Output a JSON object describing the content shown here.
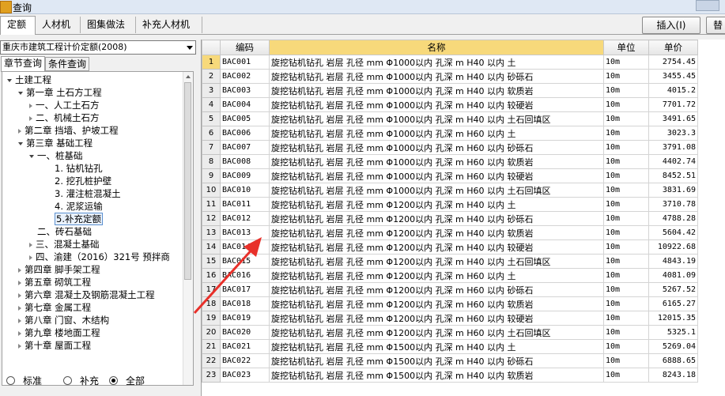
{
  "window": {
    "title": "查询",
    "icon": "app-icon"
  },
  "tabs": [
    {
      "label": "定额",
      "active": true
    },
    {
      "label": "人材机",
      "active": false
    },
    {
      "label": "图集做法",
      "active": false
    },
    {
      "label": "补充人材机",
      "active": false
    }
  ],
  "toolbar": {
    "insert_label": "插入(I)",
    "replace_label": "替"
  },
  "left": {
    "dropdown_value": "重庆市建筑工程计价定额(2008)",
    "subtabs": [
      {
        "label": "章节查询",
        "active": true
      },
      {
        "label": "条件查询",
        "active": false
      }
    ],
    "tree": [
      {
        "label": "土建工程",
        "level": 0,
        "toggle": "open"
      },
      {
        "label": "第一章  土石方工程",
        "level": 1,
        "toggle": "open"
      },
      {
        "label": "一、人工土石方",
        "level": 2,
        "toggle": "closed"
      },
      {
        "label": "二、机械土石方",
        "level": 2,
        "toggle": "closed"
      },
      {
        "label": "第二章  挡墙、护坡工程",
        "level": 1,
        "toggle": "closed"
      },
      {
        "label": "第三章  基础工程",
        "level": 1,
        "toggle": "open"
      },
      {
        "label": "一、桩基础",
        "level": 2,
        "toggle": "open"
      },
      {
        "label": "1. 钻机钻孔",
        "level": 3,
        "toggle": "none"
      },
      {
        "label": "2. 挖孔桩护壁",
        "level": 3,
        "toggle": "none"
      },
      {
        "label": "3. 灌注桩混凝土",
        "level": 3,
        "toggle": "none"
      },
      {
        "label": "4. 泥浆运输",
        "level": 3,
        "toggle": "none"
      },
      {
        "label": "5.补充定额",
        "level": 3,
        "toggle": "none",
        "selected": true
      },
      {
        "label": "二、砖石基础",
        "level": 2,
        "toggle": "none"
      },
      {
        "label": "三、混凝土基础",
        "level": 2,
        "toggle": "closed"
      },
      {
        "label": "四、渝建（2016）321号 预拌商",
        "level": 2,
        "toggle": "closed"
      },
      {
        "label": "第四章  脚手架工程",
        "level": 1,
        "toggle": "closed"
      },
      {
        "label": "第五章  砌筑工程",
        "level": 1,
        "toggle": "closed"
      },
      {
        "label": "第六章  混凝土及钢筋混凝土工程",
        "level": 1,
        "toggle": "closed"
      },
      {
        "label": "第七章  金属工程",
        "level": 1,
        "toggle": "closed"
      },
      {
        "label": "第八章  门窗、木结构",
        "level": 1,
        "toggle": "closed"
      },
      {
        "label": "第九章  楼地面工程",
        "level": 1,
        "toggle": "closed"
      },
      {
        "label": "第十章  屋面工程",
        "level": 1,
        "toggle": "closed"
      }
    ],
    "radios": [
      {
        "label": "标准",
        "checked": false
      },
      {
        "label": "补充",
        "checked": false
      },
      {
        "label": "全部",
        "checked": true
      }
    ]
  },
  "grid": {
    "headers": {
      "code": "编码",
      "name": "名称",
      "unit": "单位",
      "price": "单价"
    },
    "rows": [
      {
        "n": "1",
        "code": "BAC001",
        "name": "旋挖钻机钻孔 岩层 孔径 mm Φ1000以内 孔深 m H40 以内 土",
        "unit": "10m",
        "price": "2754.45"
      },
      {
        "n": "2",
        "code": "BAC002",
        "name": "旋挖钻机钻孔 岩层 孔径 mm Φ1000以内 孔深 m H40 以内 砂砾石",
        "unit": "10m",
        "price": "3455.45"
      },
      {
        "n": "3",
        "code": "BAC003",
        "name": "旋挖钻机钻孔 岩层 孔径 mm Φ1000以内 孔深 m H40 以内 软质岩",
        "unit": "10m",
        "price": "4015.2"
      },
      {
        "n": "4",
        "code": "BAC004",
        "name": "旋挖钻机钻孔 岩层 孔径 mm Φ1000以内 孔深 m H40 以内 较硬岩",
        "unit": "10m",
        "price": "7701.72"
      },
      {
        "n": "5",
        "code": "BAC005",
        "name": "旋挖钻机钻孔 岩层 孔径 mm Φ1000以内 孔深 m H40 以内 土石回填区",
        "unit": "10m",
        "price": "3491.65"
      },
      {
        "n": "6",
        "code": "BAC006",
        "name": "旋挖钻机钻孔 岩层 孔径 mm Φ1000以内 孔深 m H60 以内 土",
        "unit": "10m",
        "price": "3023.3"
      },
      {
        "n": "7",
        "code": "BAC007",
        "name": "旋挖钻机钻孔 岩层 孔径 mm Φ1000以内 孔深 m H60 以内 砂砾石",
        "unit": "10m",
        "price": "3791.08"
      },
      {
        "n": "8",
        "code": "BAC008",
        "name": "旋挖钻机钻孔 岩层 孔径 mm Φ1000以内 孔深 m H60 以内 软质岩",
        "unit": "10m",
        "price": "4402.74"
      },
      {
        "n": "9",
        "code": "BAC009",
        "name": "旋挖钻机钻孔 岩层 孔径 mm Φ1000以内 孔深 m H60 以内 较硬岩",
        "unit": "10m",
        "price": "8452.51"
      },
      {
        "n": "10",
        "code": "BAC010",
        "name": "旋挖钻机钻孔 岩层 孔径 mm Φ1000以内 孔深 m H60 以内 土石回填区",
        "unit": "10m",
        "price": "3831.69"
      },
      {
        "n": "11",
        "code": "BAC011",
        "name": "旋挖钻机钻孔 岩层 孔径 mm Φ1200以内 孔深 m H40 以内 土",
        "unit": "10m",
        "price": "3710.78"
      },
      {
        "n": "12",
        "code": "BAC012",
        "name": "旋挖钻机钻孔 岩层 孔径 mm Φ1200以内 孔深 m H40 以内 砂砾石",
        "unit": "10m",
        "price": "4788.28"
      },
      {
        "n": "13",
        "code": "BAC013",
        "name": "旋挖钻机钻孔 岩层 孔径 mm Φ1200以内 孔深 m H40 以内 软质岩",
        "unit": "10m",
        "price": "5604.42"
      },
      {
        "n": "14",
        "code": "BAC014",
        "name": "旋挖钻机钻孔 岩层 孔径 mm Φ1200以内 孔深 m H40 以内 较硬岩",
        "unit": "10m",
        "price": "10922.68"
      },
      {
        "n": "15",
        "code": "BAC015",
        "name": "旋挖钻机钻孔 岩层 孔径 mm Φ1200以内 孔深 m H40 以内 土石回填区",
        "unit": "10m",
        "price": "4843.19"
      },
      {
        "n": "16",
        "code": "BAC016",
        "name": "旋挖钻机钻孔 岩层 孔径 mm Φ1200以内 孔深 m H60 以内 土",
        "unit": "10m",
        "price": "4081.09"
      },
      {
        "n": "17",
        "code": "BAC017",
        "name": "旋挖钻机钻孔 岩层 孔径 mm Φ1200以内 孔深 m H60 以内 砂砾石",
        "unit": "10m",
        "price": "5267.52"
      },
      {
        "n": "18",
        "code": "BAC018",
        "name": "旋挖钻机钻孔 岩层 孔径 mm Φ1200以内 孔深 m H60 以内 软质岩",
        "unit": "10m",
        "price": "6165.27"
      },
      {
        "n": "19",
        "code": "BAC019",
        "name": "旋挖钻机钻孔 岩层 孔径 mm Φ1200以内 孔深 m H60 以内 较硬岩",
        "unit": "10m",
        "price": "12015.35"
      },
      {
        "n": "20",
        "code": "BAC020",
        "name": "旋挖钻机钻孔 岩层 孔径 mm Φ1200以内 孔深 m H60 以内 土石回填区",
        "unit": "10m",
        "price": "5325.1"
      },
      {
        "n": "21",
        "code": "BAC021",
        "name": "旋挖钻机钻孔 岩层 孔径 mm Φ1500以内 孔深 m H40 以内 土",
        "unit": "10m",
        "price": "5269.04"
      },
      {
        "n": "22",
        "code": "BAC022",
        "name": "旋挖钻机钻孔 岩层 孔径 mm Φ1500以内 孔深 m H40 以内 砂砾石",
        "unit": "10m",
        "price": "6888.65"
      },
      {
        "n": "23",
        "code": "BAC023",
        "name": "旋挖钻机钻孔 岩层 孔径 mm Φ1500以内 孔深 m H40 以内 软质岩",
        "unit": "10m",
        "price": "8243.18"
      }
    ],
    "selected_row": 1
  },
  "colors": {
    "header_highlight": "#f7d97b",
    "annotation_arrow": "#e8302a"
  }
}
